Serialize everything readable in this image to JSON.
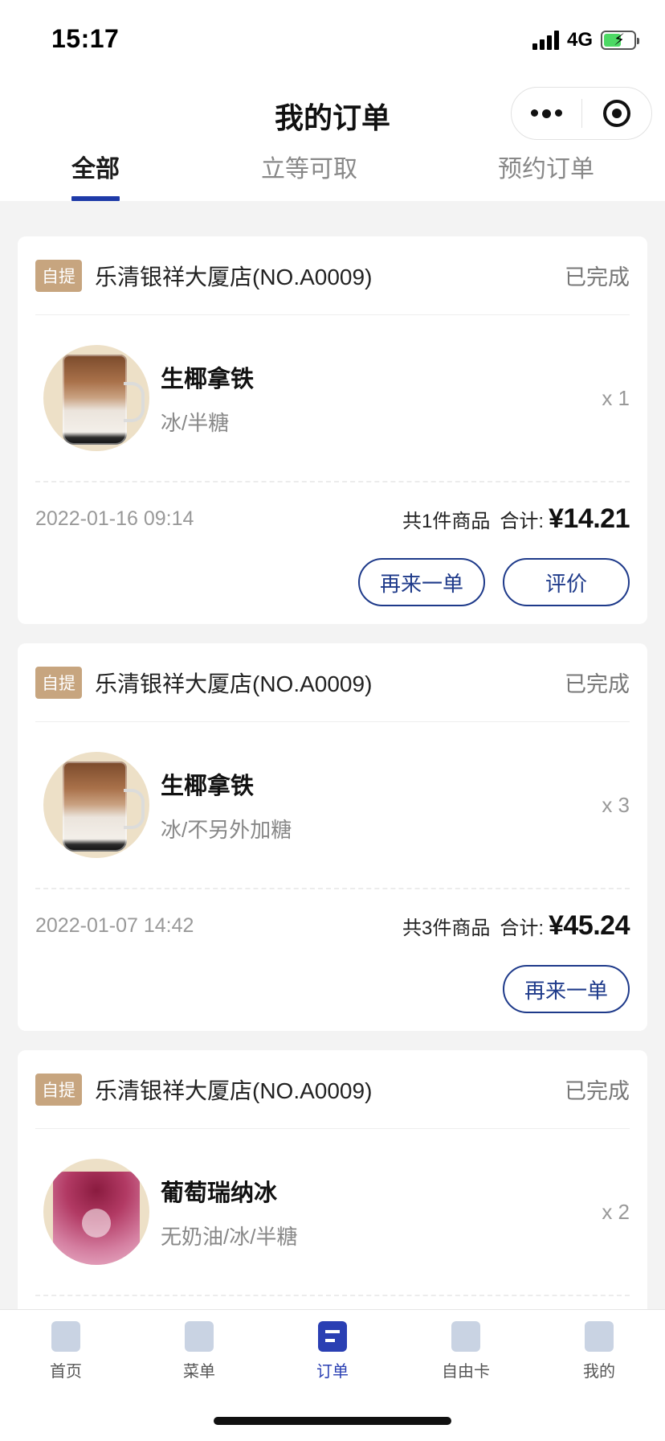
{
  "status_bar": {
    "time": "15:17",
    "network": "4G"
  },
  "header": {
    "title": "我的订单"
  },
  "tabs": [
    {
      "label": "全部",
      "active": true
    },
    {
      "label": "立等可取",
      "active": false
    },
    {
      "label": "预约订单",
      "active": false
    }
  ],
  "orders": [
    {
      "tag": "自提",
      "store": "乐清银祥大厦店(NO.A0009)",
      "status": "已完成",
      "item": {
        "name": "生椰拿铁",
        "spec": "冰/半糖",
        "qty": "x 1"
      },
      "date": "2022-01-16 09:14",
      "count": "共1件商品",
      "total_label": "合计:",
      "price": "¥14.21",
      "buttons": [
        "再来一单",
        "评价"
      ]
    },
    {
      "tag": "自提",
      "store": "乐清银祥大厦店(NO.A0009)",
      "status": "已完成",
      "item": {
        "name": "生椰拿铁",
        "spec": "冰/不另外加糖",
        "qty": "x 3"
      },
      "date": "2022-01-07 14:42",
      "count": "共3件商品",
      "total_label": "合计:",
      "price": "¥45.24",
      "buttons": [
        "再来一单"
      ]
    },
    {
      "tag": "自提",
      "store": "乐清银祥大厦店(NO.A0009)",
      "status": "已完成",
      "item": {
        "name": "葡萄瑞纳冰",
        "spec": "无奶油/冰/半糖",
        "qty": "x 2"
      }
    }
  ],
  "bottom_nav": [
    {
      "label": "首页",
      "icon": "home-icon"
    },
    {
      "label": "菜单",
      "icon": "cup-icon"
    },
    {
      "label": "订单",
      "icon": "order-icon",
      "active": true
    },
    {
      "label": "自由卡",
      "icon": "crown-icon"
    },
    {
      "label": "我的",
      "icon": "deer-icon"
    }
  ],
  "colors": {
    "accent": "#1e3a8a",
    "tag": "#c7a57f",
    "tab_active": "#1e3aa8"
  }
}
